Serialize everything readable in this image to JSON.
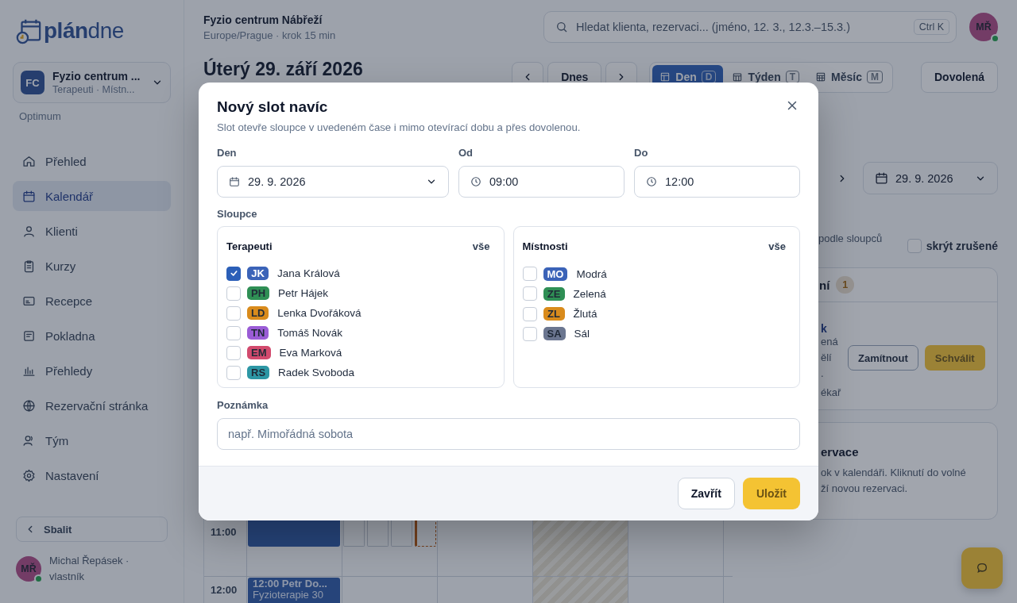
{
  "brand": {
    "bold": "plán",
    "light": "dne"
  },
  "workspace": {
    "initials": "FC",
    "name": "Fyzio centrum ...",
    "subtitle": "Terapeuti · Místn...",
    "plan": "Optimum"
  },
  "sidebar": {
    "items": [
      {
        "label": "Přehled",
        "kind": "home",
        "selected": false
      },
      {
        "label": "Kalendář",
        "kind": "calendar",
        "selected": true
      },
      {
        "label": "Klienti",
        "kind": "person",
        "selected": false
      },
      {
        "label": "Kurzy",
        "kind": "clipboard",
        "selected": false
      },
      {
        "label": "Recepce",
        "kind": "card",
        "selected": false
      },
      {
        "label": "Pokladna",
        "kind": "receipt",
        "selected": false
      },
      {
        "label": "Přehledy",
        "kind": "bars",
        "selected": false
      },
      {
        "label": "Rezervační stránka",
        "kind": "globe",
        "selected": false
      },
      {
        "label": "Tým",
        "kind": "people",
        "selected": false
      },
      {
        "label": "Nastavení",
        "kind": "gear",
        "selected": false
      }
    ]
  },
  "collapse_button": "Sbalit",
  "user": {
    "initials": "MŘ",
    "name": "Michal Řepásek · vlastník",
    "online": true
  },
  "header": {
    "title": "Fyzio centrum Nábřeží",
    "subtitle": "Europe/Prague · krok 15 min",
    "search": {
      "placeholder": "Hledat klienta, rezervaci... (jméno, 12. 3., 12.3.–15.3.)",
      "shortcut": "Ctrl K"
    },
    "avatar": {
      "initials": "MŘ",
      "online": true
    }
  },
  "toolbar": {
    "date_title": "Úterý 29. září 2026",
    "today": "Dnes",
    "views": [
      {
        "label": "Den",
        "key": "D",
        "kind": "day",
        "selected": true
      },
      {
        "label": "Týden",
        "key": "T",
        "kind": "week",
        "selected": false
      },
      {
        "label": "Měsíc",
        "key": "M",
        "kind": "month",
        "selected": false
      }
    ],
    "vacation_button": "Dovolená"
  },
  "side_panel": {
    "date_picker": "29. 9. 2026",
    "column_toggle_fragment": "podle sloupců",
    "hide_cancelled": {
      "label": "skrýt zrušené",
      "checked": false
    },
    "pending": {
      "title_fragment": "ní",
      "count": "1",
      "name_fragment": "k",
      "detail_lines": [
        "ená",
        "ělí",
        "."
      ],
      "note_fragment": "ékař",
      "reject": "Zamítnout",
      "approve": "Schválit"
    },
    "help": {
      "title_fragment": "ervace",
      "lines": [
        "ok v kalendáři. Kliknutí do volné",
        "ží novou rezervaci."
      ]
    }
  },
  "calendar": {
    "rows": [
      {
        "time": "11:00"
      },
      {
        "time": "12:00"
      }
    ],
    "event": {
      "title": "12:00 Petr Do...",
      "service": "Fyzioterapie 30"
    }
  },
  "modal": {
    "title": "Nový slot navíc",
    "description": "Slot otevře sloupce v uvedeném čase i mimo otevírací dobu a přes dovolenou.",
    "day": {
      "label": "Den",
      "value": "29. 9. 2026"
    },
    "from": {
      "label": "Od",
      "value": "09:00"
    },
    "to": {
      "label": "Do",
      "value": "12:00"
    },
    "columns_label": "Sloupce",
    "groups": [
      {
        "title": "Terapeuti",
        "all": "vše",
        "items": [
          {
            "initials": "JK",
            "name": "Jana Králová",
            "color": "#3b63b8",
            "checked": true
          },
          {
            "initials": "PH",
            "name": "Petr Hájek",
            "color": "#2f8f55",
            "checked": false
          },
          {
            "initials": "LD",
            "name": "Lenka Dvořáková",
            "color": "#d98b1c",
            "checked": false
          },
          {
            "initials": "TN",
            "name": "Tomáš Novák",
            "color": "#9a5cd6",
            "checked": false
          },
          {
            "initials": "EM",
            "name": "Eva Marková",
            "color": "#d24a6e",
            "checked": false
          },
          {
            "initials": "RS",
            "name": "Radek Svoboda",
            "color": "#2d97a5",
            "checked": false
          }
        ]
      },
      {
        "title": "Místnosti",
        "all": "vše",
        "items": [
          {
            "initials": "MO",
            "name": "Modrá",
            "color": "#3b63b8",
            "checked": false
          },
          {
            "initials": "ZE",
            "name": "Zelená",
            "color": "#2f8f55",
            "checked": false
          },
          {
            "initials": "ZL",
            "name": "Žlutá",
            "color": "#d98b1c",
            "checked": false
          },
          {
            "initials": "SA",
            "name": "Sál",
            "color": "#6b7690",
            "checked": false
          }
        ]
      }
    ],
    "note": {
      "label": "Poznámka",
      "placeholder": "např. Mimořádná sobota"
    },
    "close_button": "Zavřít",
    "save_button": "Uložit"
  }
}
